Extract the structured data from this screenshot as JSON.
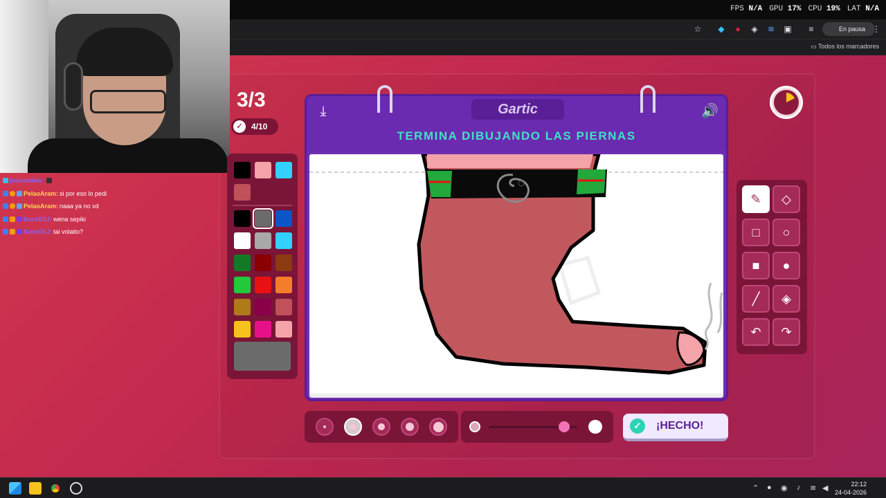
{
  "top_bar": {
    "stats": [
      {
        "label": "FPS",
        "value": "N/A"
      },
      {
        "label": "GPU",
        "value": "17%"
      },
      {
        "label": "CPU",
        "value": "19%"
      },
      {
        "label": "LAT",
        "value": "N/A"
      }
    ]
  },
  "browser": {
    "paused_label": "En pausa",
    "bookmarks_all": "Todos los marcadores"
  },
  "chat": {
    "messages": [
      {
        "user": "joacotulon:",
        "text": "",
        "user_color": "#8a63f0"
      },
      {
        "user": "PelaoAram:",
        "text": "si por eso lo pedi",
        "user_color": "#f5d84a"
      },
      {
        "user": "PelaoAram:",
        "text": "naaa ya no xd",
        "user_color": "#f5d84a"
      },
      {
        "user": "KuroSSJ:",
        "text": "wena sepiki",
        "user_color": "#8a63f0"
      },
      {
        "user": "KuroSSJ:",
        "text": "tai volaito?",
        "user_color": "#8a63f0"
      }
    ]
  },
  "game": {
    "round": "3/3",
    "progress": "4/10",
    "brand": "Gartic",
    "prompt": "TERMINA DIBUJANDO LAS PIERNAS",
    "done_label": "¡HECHO!",
    "palette": {
      "recent": [
        "#000000",
        "#f4a3a8",
        "#33d1ff",
        "#c0505a"
      ],
      "colors": [
        "#000000",
        "#6b6b6b",
        "#0b55c9",
        "#ffffff",
        "#a8a8a8",
        "#33d1ff",
        "#127a25",
        "#8a0000",
        "#8b3a12",
        "#22c93b",
        "#e81010",
        "#f47d2a",
        "#b07a1a",
        "#8a0048",
        "#c0505a",
        "#f6c21b",
        "#e8108a",
        "#f4a3a8"
      ],
      "selected_color": "#6b6b6b"
    },
    "tools": [
      "pencil",
      "eraser",
      "rectangle-outline",
      "ellipse-outline",
      "rectangle-fill",
      "ellipse-fill",
      "line",
      "bucket",
      "undo",
      "redo"
    ],
    "active_tool": "pencil",
    "brush_sizes": [
      1,
      2,
      3,
      4,
      5
    ],
    "active_brush_size": 2,
    "opacity_level": 0.85
  },
  "taskbar": {
    "time": "22:12",
    "date": "24-04-2026"
  },
  "colors": {
    "accent_purple": "#6e2eb4",
    "prompt_teal": "#3fe2c4",
    "background_red": "#c42a4e"
  }
}
